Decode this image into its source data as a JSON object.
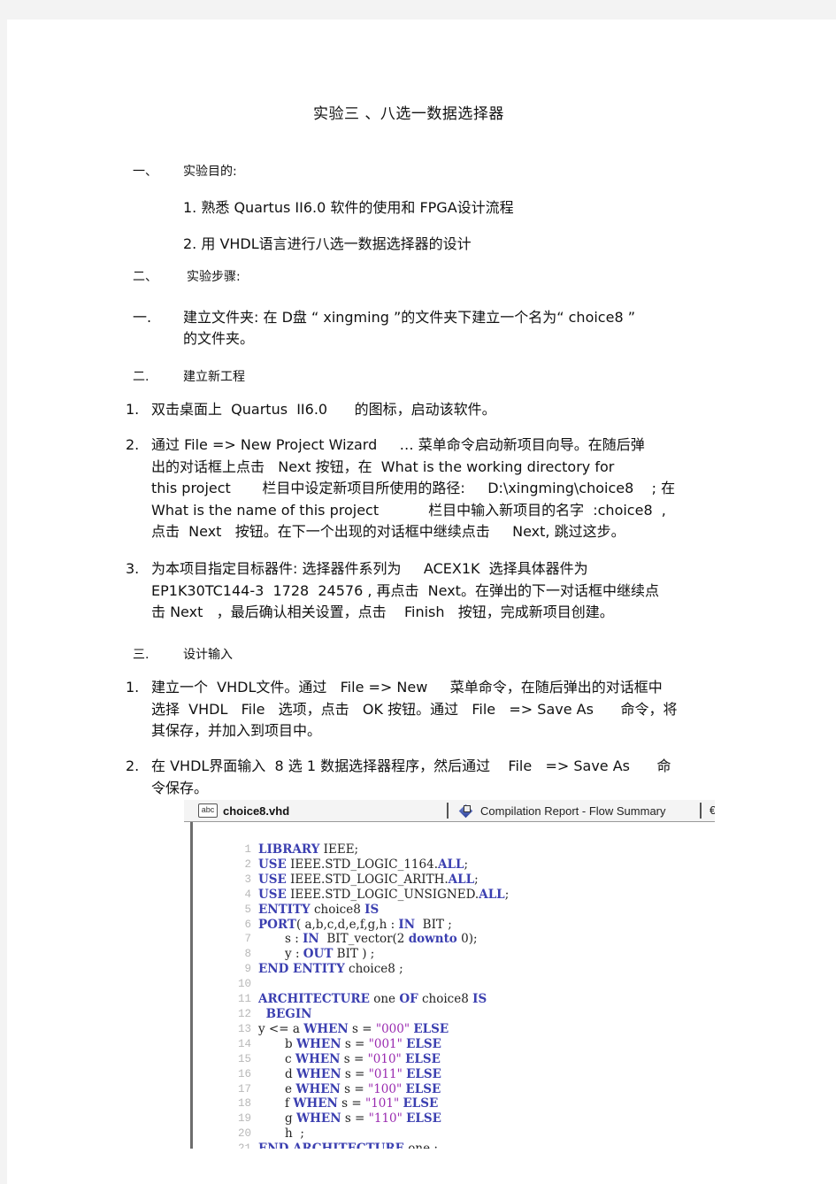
{
  "document": {
    "title": "实验三 、八选一数据选择器",
    "sections": [
      {
        "marker": "一、",
        "heading": "实验目的:",
        "items": [
          "1. 熟悉 Quartus  II6.0     软件的使用和   FPGA设计流程",
          "2. 用 VHDL语言进行八选一数据选择器的设计"
        ]
      },
      {
        "marker": "二、",
        "heading": "实验步骤:"
      }
    ],
    "steps": [
      {
        "marker": "一.",
        "heading": "建立文件夹:   在 D盘 “  xingming ”的文件夹下建立一个名为“       choice8 ”",
        "continuation": "的文件夹。"
      },
      {
        "marker": "二.",
        "heading": "建立新工程",
        "items": [
          {
            "n": "1.",
            "text": "双击桌面上  Quartus  II6.0      的图标，启动该软件。"
          },
          {
            "n": "2.",
            "lines": [
              "通过 File => New Project Wizard     … 菜单命令启动新项目向导。在随后弹",
              "出的对话框上点击   Next 按钮，在  What is the working directory for",
              "this project       栏目中设定新项目所使用的路径:     D:\\xingming\\choice8    ; 在",
              "What is the name of this project           栏目中输入新项目的名字  :choice8  ,",
              "点击  Next   按钮。在下一个出现的对话框中继续点击     Next, 跳过这步。"
            ]
          },
          {
            "n": "3.",
            "lines": [
              "为本项目指定目标器件: 选择器件系列为     ACEX1K  选择具体器件为",
              "EP1K30TC144-3  1728  24576 , 再点击  Next。在弹出的下一对话框中继续点",
              "击 Next   ，最后确认相关设置，点击    Finish   按钮，完成新项目创建。"
            ]
          }
        ]
      },
      {
        "marker": "三.",
        "heading": "设计输入",
        "items": [
          {
            "n": "1.",
            "lines": [
              "建立一个  VHDL文件。通过   File => New     菜单命令，在随后弹出的对话框中",
              "选择  VHDL   File   选项，点击   OK 按钮。通过   File   => Save As      命令，将",
              "其保存，并加入到项目中。"
            ]
          },
          {
            "n": "2.",
            "lines": [
              "在 VHDL界面输入  8 选 1 数据选择器程序，然后通过    File   => Save As      命",
              "令保存。"
            ]
          }
        ]
      }
    ]
  },
  "editor": {
    "tabs": [
      {
        "label": "choice8.vhd",
        "icon": "abc-file-icon",
        "active": true
      },
      {
        "label": "Compilation Report - Flow Summary",
        "icon": "report-icon",
        "active": false
      },
      {
        "label": "€",
        "icon": "",
        "active": false
      }
    ],
    "abc_icon_text": "abc",
    "code_lines": [
      {
        "n": "1",
        "tokens": [
          [
            "kw",
            "LIBRARY"
          ],
          [
            "tx",
            " IEEE;"
          ]
        ]
      },
      {
        "n": "2",
        "tokens": [
          [
            "kw",
            "USE"
          ],
          [
            "tx",
            " IEEE.STD_LOGIC_1164."
          ],
          [
            "kw",
            "ALL"
          ],
          [
            "tx",
            ";"
          ]
        ]
      },
      {
        "n": "3",
        "tokens": [
          [
            "kw",
            "USE"
          ],
          [
            "tx",
            " IEEE.STD_LOGIC_ARITH."
          ],
          [
            "kw",
            "ALL"
          ],
          [
            "tx",
            ";"
          ]
        ]
      },
      {
        "n": "4",
        "tokens": [
          [
            "kw",
            "USE"
          ],
          [
            "tx",
            " IEEE.STD_LOGIC_UNSIGNED."
          ],
          [
            "kw",
            "ALL"
          ],
          [
            "tx",
            ";"
          ]
        ]
      },
      {
        "n": "5",
        "tokens": [
          [
            "kw",
            "ENTITY"
          ],
          [
            "tx",
            " choice8 "
          ],
          [
            "kw",
            "IS"
          ]
        ]
      },
      {
        "n": "6",
        "tokens": [
          [
            "kw",
            "PORT"
          ],
          [
            "tx",
            "( a,b,c,d,e,f,g,h : "
          ],
          [
            "kw",
            "IN"
          ],
          [
            "tx",
            "  BIT ;"
          ]
        ]
      },
      {
        "n": "7",
        "tokens": [
          [
            "tx",
            "       s : "
          ],
          [
            "kw",
            "IN"
          ],
          [
            "tx",
            "  BIT_vector(2 "
          ],
          [
            "kw",
            "downto"
          ],
          [
            "tx",
            " 0);"
          ]
        ]
      },
      {
        "n": "8",
        "tokens": [
          [
            "tx",
            "       y : "
          ],
          [
            "kw",
            "OUT"
          ],
          [
            "tx",
            " BIT ) ;"
          ]
        ]
      },
      {
        "n": "9",
        "tokens": [
          [
            "kw",
            "END ENTITY"
          ],
          [
            "tx",
            " choice8 ;"
          ]
        ]
      },
      {
        "n": "10",
        "tokens": []
      },
      {
        "n": "11",
        "tokens": [
          [
            "kw",
            "ARCHITECTURE"
          ],
          [
            "tx",
            " one "
          ],
          [
            "kw",
            "OF"
          ],
          [
            "tx",
            " choice8 "
          ],
          [
            "kw",
            "IS"
          ]
        ]
      },
      {
        "n": "12",
        "tokens": [
          [
            "tx",
            "  "
          ],
          [
            "kw",
            "BEGIN"
          ]
        ]
      },
      {
        "n": "13",
        "tokens": [
          [
            "tx",
            "y <= a "
          ],
          [
            "kw",
            "WHEN"
          ],
          [
            "tx",
            " s = "
          ],
          [
            "str",
            "\"000\""
          ],
          [
            "tx",
            " "
          ],
          [
            "kw",
            "ELSE"
          ]
        ]
      },
      {
        "n": "14",
        "tokens": [
          [
            "tx",
            "       b "
          ],
          [
            "kw",
            "WHEN"
          ],
          [
            "tx",
            " s = "
          ],
          [
            "str",
            "\"001\""
          ],
          [
            "tx",
            " "
          ],
          [
            "kw",
            "ELSE"
          ]
        ]
      },
      {
        "n": "15",
        "tokens": [
          [
            "tx",
            "       c "
          ],
          [
            "kw",
            "WHEN"
          ],
          [
            "tx",
            " s = "
          ],
          [
            "str",
            "\"010\""
          ],
          [
            "tx",
            " "
          ],
          [
            "kw",
            "ELSE"
          ]
        ]
      },
      {
        "n": "16",
        "tokens": [
          [
            "tx",
            "       d "
          ],
          [
            "kw",
            "WHEN"
          ],
          [
            "tx",
            " s = "
          ],
          [
            "str",
            "\"011\""
          ],
          [
            "tx",
            " "
          ],
          [
            "kw",
            "ELSE"
          ]
        ]
      },
      {
        "n": "17",
        "tokens": [
          [
            "tx",
            "       e "
          ],
          [
            "kw",
            "WHEN"
          ],
          [
            "tx",
            " s = "
          ],
          [
            "str",
            "\"100\""
          ],
          [
            "tx",
            " "
          ],
          [
            "kw",
            "ELSE"
          ]
        ]
      },
      {
        "n": "18",
        "tokens": [
          [
            "tx",
            "       f "
          ],
          [
            "kw",
            "WHEN"
          ],
          [
            "tx",
            " s = "
          ],
          [
            "str",
            "\"101\""
          ],
          [
            "tx",
            " "
          ],
          [
            "kw",
            "ELSE"
          ]
        ]
      },
      {
        "n": "19",
        "tokens": [
          [
            "tx",
            "       g "
          ],
          [
            "kw",
            "WHEN"
          ],
          [
            "tx",
            " s = "
          ],
          [
            "str",
            "\"110\""
          ],
          [
            "tx",
            " "
          ],
          [
            "kw",
            "ELSE"
          ]
        ]
      },
      {
        "n": "20",
        "tokens": [
          [
            "tx",
            "       h  ;"
          ]
        ]
      },
      {
        "n": "21",
        "tokens": [
          [
            "kw",
            "END ARCHITECTURE"
          ],
          [
            "tx",
            " one ;"
          ]
        ]
      }
    ]
  }
}
